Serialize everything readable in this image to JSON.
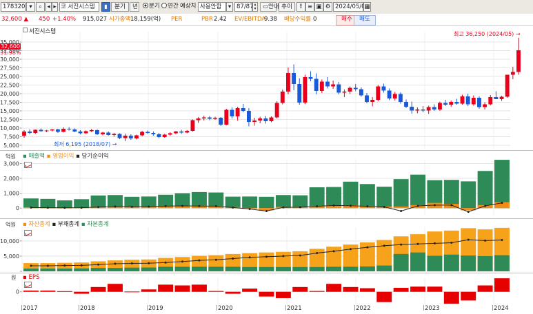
{
  "toolbar": {
    "stock_code": "178320",
    "company_name": "서진시스템",
    "market_icon": "코",
    "period_label": "분기",
    "period_year_label": "년",
    "radio_quarter": "분기",
    "radio_annual": "연간",
    "estimate_label": "예상치",
    "usage_label": "사용안함",
    "page_counter": "87/87",
    "guide_button": "안내",
    "add_button": "추이",
    "date": "2024/05/02",
    "icons": [
      "dropdown-arrow-icon",
      "search-icon",
      "prev-icon",
      "next-icon",
      "info-icon",
      "exclaim-icon",
      "list-icon",
      "save-icon",
      "settings-icon",
      "calendar-icon"
    ]
  },
  "infobar": {
    "price": "32,600",
    "change": "450",
    "change_pct": "+1.40%",
    "volume": "915,027",
    "market_cap_label": "시가총액",
    "market_cap_value": "18,159(억)",
    "per_label": "PER",
    "per_value": "",
    "pbr_label": "PBR",
    "pbr_value": "2.42",
    "ev_label": "EV/EBITDA",
    "ev_value": "9.38",
    "div_label": "배당수익률",
    "div_value": "0",
    "buy_button": "매수",
    "sell_button": "매도",
    "colors": {
      "up": "#e8001c",
      "down": "#1a5ad6",
      "label": "#e07a00"
    }
  },
  "price_pane": {
    "title": "서진시스템",
    "current_price_tag": "32,600",
    "current_pct_tag": "31.98%",
    "high_annotation": "최고 36,250 (2024/05)",
    "low_annotation": "최저 6,195 (2018/07)"
  },
  "sales_pane": {
    "unit": "억원",
    "legend": [
      "매출액",
      "영업이익",
      "당기순이익"
    ],
    "colors": [
      "#2e8b57",
      "#f28c13",
      "#222222"
    ]
  },
  "balance_pane": {
    "unit": "억원",
    "legend": [
      "자산총계",
      "부채총계",
      "자본총계"
    ],
    "colors": [
      "#f7a21b",
      "#222222",
      "#2e8b57"
    ]
  },
  "eps_pane": {
    "unit": "원",
    "legend": [
      "EPS"
    ],
    "colors": [
      "#e60000"
    ]
  },
  "x_axis": {
    "labels": [
      "2017",
      "2018",
      "2019",
      "2020",
      "2021",
      "2022",
      "2023",
      "2024"
    ]
  },
  "chart_data": [
    {
      "type": "candlestick",
      "title": "서진시스템",
      "x": [
        "2017-01",
        "2024-05"
      ],
      "ylim": [
        4000,
        38000
      ],
      "yticks": [
        5000,
        7500,
        10000,
        12500,
        15000,
        17500,
        20000,
        22500,
        25000,
        27500,
        30000,
        32500,
        35000
      ],
      "ytick_labels": [
        "5,000",
        "7,500",
        "10,000",
        "12,500",
        "15,000",
        "17,500",
        "20,000",
        "22,500",
        "25,000",
        "27,500",
        "30,000",
        "32,500",
        "35,000"
      ],
      "ohlc": [
        [
          7800,
          9400,
          7200,
          9000
        ],
        [
          9000,
          9600,
          8200,
          8600
        ],
        [
          8600,
          9600,
          8300,
          9500
        ],
        [
          9500,
          9900,
          8900,
          9100
        ],
        [
          9100,
          9500,
          8800,
          9300
        ],
        [
          9300,
          9700,
          9000,
          9600
        ],
        [
          9600,
          9800,
          8600,
          8900
        ],
        [
          8900,
          10200,
          8700,
          9800
        ],
        [
          9800,
          10300,
          9300,
          9600
        ],
        [
          9600,
          9900,
          8800,
          9000
        ],
        [
          9000,
          9400,
          8200,
          8500
        ],
        [
          8500,
          9300,
          8300,
          9100
        ],
        [
          9100,
          9800,
          8800,
          9400
        ],
        [
          9400,
          9600,
          8000,
          8200
        ],
        [
          8200,
          8900,
          7900,
          8700
        ],
        [
          8700,
          9000,
          7800,
          8000
        ],
        [
          8000,
          8600,
          7500,
          8300
        ],
        [
          8300,
          8500,
          6800,
          7100
        ],
        [
          7100,
          8400,
          6195,
          7800
        ],
        [
          7800,
          8200,
          6600,
          7000
        ],
        [
          7000,
          8100,
          6700,
          7900
        ],
        [
          7900,
          9200,
          7600,
          8900
        ],
        [
          8900,
          9300,
          8300,
          8600
        ],
        [
          8600,
          9000,
          7800,
          8200
        ],
        [
          8200,
          8600,
          7100,
          7400
        ],
        [
          7400,
          8300,
          7200,
          8100
        ],
        [
          8100,
          8800,
          7800,
          8500
        ],
        [
          8500,
          9200,
          8200,
          9000
        ],
        [
          9000,
          9500,
          8300,
          8700
        ],
        [
          8700,
          9400,
          8500,
          9200
        ],
        [
          9200,
          12500,
          9000,
          12300
        ],
        [
          12300,
          13200,
          11500,
          12800
        ],
        [
          12800,
          13600,
          12200,
          13100
        ],
        [
          13100,
          13500,
          12300,
          12700
        ],
        [
          12700,
          13300,
          12400,
          13000
        ],
        [
          13000,
          13200,
          10600,
          11000
        ],
        [
          11000,
          15600,
          10800,
          15300
        ],
        [
          15300,
          16000,
          12800,
          13400
        ],
        [
          13400,
          16200,
          12200,
          15800
        ],
        [
          15800,
          17000,
          14600,
          15000
        ],
        [
          15000,
          15800,
          10500,
          11800
        ],
        [
          11800,
          13000,
          10700,
          12200
        ],
        [
          12200,
          13300,
          11400,
          12800
        ],
        [
          12800,
          13500,
          11300,
          12000
        ],
        [
          12000,
          13400,
          11700,
          13100
        ],
        [
          13100,
          17800,
          12800,
          17300
        ],
        [
          17300,
          21200,
          16900,
          20600
        ],
        [
          20600,
          27600,
          19800,
          26000
        ],
        [
          26000,
          28500,
          21000,
          22800
        ],
        [
          22800,
          24500,
          16800,
          17400
        ],
        [
          17400,
          25500,
          17000,
          24800
        ],
        [
          24800,
          26500,
          23600,
          24300
        ],
        [
          24300,
          25900,
          19800,
          20800
        ],
        [
          20800,
          24100,
          20200,
          23500
        ],
        [
          23500,
          24800,
          21500,
          22100
        ],
        [
          22100,
          23800,
          21400,
          22700
        ],
        [
          22700,
          23400,
          19800,
          20300
        ],
        [
          20300,
          21200,
          19000,
          20600
        ],
        [
          20600,
          22100,
          19900,
          21700
        ],
        [
          21700,
          22800,
          20700,
          21300
        ],
        [
          21300,
          21800,
          19100,
          19500
        ],
        [
          19500,
          20200,
          17200,
          17600
        ],
        [
          17600,
          19000,
          16300,
          18200
        ],
        [
          18200,
          22500,
          17800,
          22100
        ],
        [
          22100,
          22900,
          20300,
          20900
        ],
        [
          20900,
          21500,
          18100,
          18600
        ],
        [
          18600,
          20500,
          18000,
          19900
        ],
        [
          19900,
          20400,
          17100,
          17600
        ],
        [
          17600,
          18300,
          15800,
          16200
        ],
        [
          16200,
          17700,
          14200,
          15100
        ],
        [
          15100,
          16000,
          14300,
          15400
        ],
        [
          15400,
          16400,
          14600,
          15100
        ],
        [
          15100,
          16500,
          14100,
          16100
        ],
        [
          16100,
          16900,
          15000,
          15400
        ],
        [
          15400,
          17700,
          15000,
          17300
        ],
        [
          17300,
          18200,
          16400,
          16800
        ],
        [
          16800,
          18000,
          16200,
          17600
        ],
        [
          17600,
          18500,
          16800,
          17100
        ],
        [
          17100,
          19700,
          16800,
          19200
        ],
        [
          19200,
          20000,
          16400,
          16900
        ],
        [
          16900,
          19500,
          16500,
          18800
        ],
        [
          18800,
          19200,
          15600,
          16100
        ],
        [
          16100,
          17500,
          15400,
          16900
        ],
        [
          16900,
          19600,
          16600,
          19000
        ],
        [
          19000,
          20700,
          18600,
          18400
        ],
        [
          18400,
          19400,
          17900,
          19100
        ],
        [
          19100,
          24100,
          18800,
          25500
        ],
        [
          25500,
          27800,
          24200,
          26300
        ],
        [
          26300,
          36250,
          25500,
          32600
        ]
      ],
      "high": {
        "value": 36250,
        "label": "2024/05"
      },
      "low": {
        "value": 6195,
        "label": "2018/07"
      }
    },
    {
      "type": "bar",
      "title": "",
      "ylabel": "억원",
      "ylim": [
        -500,
        3300
      ],
      "yticks": [
        0,
        1000,
        2000,
        3000
      ],
      "ytick_labels": [
        "0",
        "1,000",
        "2,000",
        "3,000"
      ],
      "categories": [
        "2017Q1",
        "2017Q2",
        "2017Q3",
        "2017Q4",
        "2018Q1",
        "2018Q2",
        "2018Q3",
        "2018Q4",
        "2019Q1",
        "2019Q2",
        "2019Q3",
        "2019Q4",
        "2020Q1",
        "2020Q2",
        "2020Q3",
        "2020Q4",
        "2021Q1",
        "2021Q2",
        "2021Q3",
        "2021Q4",
        "2022Q1",
        "2022Q2",
        "2022Q3",
        "2022Q4",
        "2023Q1",
        "2023Q2",
        "2023Q3",
        "2023Q4",
        "2024Q1"
      ],
      "series": [
        {
          "name": "매출액",
          "values": [
            650,
            620,
            520,
            600,
            850,
            880,
            760,
            780,
            900,
            1000,
            1080,
            1050,
            770,
            780,
            760,
            880,
            860,
            1400,
            1420,
            1780,
            1620,
            1440,
            1950,
            2250,
            1880,
            1900,
            1800,
            2500,
            3250
          ]
        },
        {
          "name": "영업이익",
          "values": [
            60,
            40,
            30,
            50,
            90,
            130,
            110,
            120,
            150,
            170,
            160,
            150,
            70,
            -20,
            -150,
            80,
            90,
            150,
            200,
            200,
            150,
            100,
            100,
            200,
            350,
            280,
            -150,
            200,
            400
          ]
        },
        {
          "name": "당기순이익",
          "values": [
            40,
            30,
            20,
            30,
            70,
            110,
            90,
            100,
            130,
            150,
            140,
            130,
            40,
            -60,
            -200,
            50,
            60,
            120,
            180,
            160,
            120,
            80,
            -200,
            150,
            200,
            200,
            -250,
            150,
            350
          ]
        }
      ]
    },
    {
      "type": "bar",
      "title": "",
      "ylabel": "억원",
      "ylim": [
        0,
        14500
      ],
      "yticks": [
        0,
        5000,
        10000
      ],
      "ytick_labels": [
        "",
        "5,000",
        "10,000"
      ],
      "categories": [
        "2017Q1",
        "2017Q2",
        "2017Q3",
        "2017Q4",
        "2018Q1",
        "2018Q2",
        "2018Q3",
        "2018Q4",
        "2019Q1",
        "2019Q2",
        "2019Q3",
        "2019Q4",
        "2020Q1",
        "2020Q2",
        "2020Q3",
        "2020Q4",
        "2021Q1",
        "2021Q2",
        "2021Q3",
        "2021Q4",
        "2022Q1",
        "2022Q2",
        "2022Q3",
        "2022Q4",
        "2023Q1",
        "2023Q2",
        "2023Q3",
        "2023Q4",
        "2024Q1"
      ],
      "series": [
        {
          "name": "자산총계",
          "values": [
            2700,
            2700,
            2800,
            2900,
            3300,
            3600,
            3800,
            3900,
            4400,
            4700,
            5100,
            5300,
            5700,
            6000,
            6200,
            6400,
            6600,
            7400,
            8100,
            8800,
            9500,
            10300,
            11500,
            12200,
            13100,
            13400,
            14200,
            13800,
            14300
          ]
        },
        {
          "name": "부채총계",
          "values": [
            1800,
            1800,
            1900,
            1950,
            2200,
            2500,
            2600,
            2650,
            2900,
            3200,
            3600,
            3800,
            4200,
            4600,
            4800,
            5000,
            5200,
            6000,
            6600,
            7300,
            7900,
            8400,
            8800,
            9000,
            9200,
            9400,
            10400,
            10100,
            10300
          ]
        },
        {
          "name": "자본총계",
          "values": [
            900,
            900,
            900,
            950,
            1100,
            1100,
            1200,
            1250,
            1500,
            1500,
            1500,
            1500,
            1500,
            1400,
            1400,
            1400,
            1400,
            1400,
            1500,
            1500,
            1600,
            1900,
            5700,
            6200,
            5100,
            5500,
            5200,
            5000,
            5300
          ]
        }
      ]
    },
    {
      "type": "bar",
      "title": "",
      "ylabel": "원",
      "ylim": [
        -1500,
        1800
      ],
      "yticks": [
        0
      ],
      "ytick_labels": [
        "0"
      ],
      "categories": [
        "2017Q1",
        "2017Q2",
        "2017Q3",
        "2017Q4",
        "2018Q1",
        "2018Q2",
        "2018Q3",
        "2018Q4",
        "2019Q1",
        "2019Q2",
        "2019Q3",
        "2019Q4",
        "2020Q1",
        "2020Q2",
        "2020Q3",
        "2020Q4",
        "2021Q1",
        "2021Q2",
        "2021Q3",
        "2021Q4",
        "2022Q1",
        "2022Q2",
        "2022Q3",
        "2022Q4",
        "2023Q1",
        "2023Q2",
        "2023Q3",
        "2023Q4",
        "2024Q1"
      ],
      "series": [
        {
          "name": "EPS",
          "values": [
            150,
            150,
            80,
            -250,
            600,
            1000,
            30,
            300,
            900,
            800,
            900,
            100,
            -250,
            400,
            -600,
            -800,
            600,
            100,
            1000,
            600,
            450,
            -1300,
            500,
            650,
            650,
            -1500,
            -1100,
            800,
            1700
          ]
        }
      ]
    }
  ]
}
